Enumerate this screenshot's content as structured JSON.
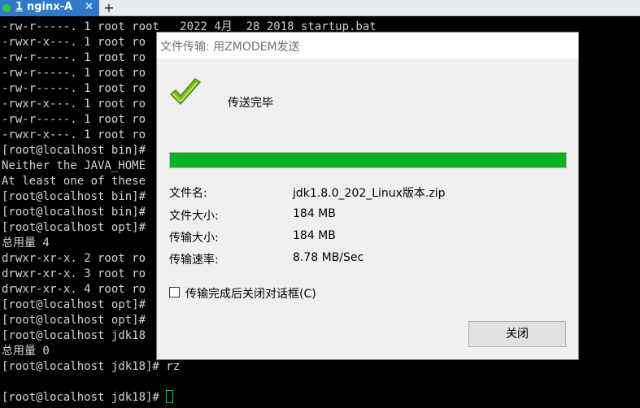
{
  "tabbar": {
    "active_tab": {
      "number": "1",
      "title": "nginx-A",
      "close_glyph": "✕",
      "status_color": "#27c93f",
      "color": "#3079c8"
    },
    "add_tab_glyph": "+"
  },
  "terminal": {
    "lines": [
      "-rw-r-----. 1 root root   2022 4月  28 2018 startup.bat",
      "-rwxr-x---. 1 root ro",
      "-rw-r-----. 1 root ro",
      "-rw-r-----. 1 root ro",
      "-rw-r-----. 1 root ro",
      "-rwxr-x---. 1 root ro",
      "-rw-r-----. 1 root ro",
      "-rwxr-x---. 1 root ro",
      "[root@localhost bin]#",
      "Neither the JAVA_HOME",
      "At least one of these",
      "[root@localhost bin]#",
      "[root@localhost bin]#",
      "[root@localhost opt]#",
      "总用量 4",
      "drwxr-xr-x. 2 root ro",
      "drwxr-xr-x. 3 root ro",
      "drwxr-xr-x. 4 root ro",
      "[root@localhost opt]#",
      "[root@localhost opt]#",
      "[root@localhost jdk18",
      "总用量 0",
      "[root@localhost jdk18]# rz",
      "",
      "[root@localhost jdk18]# "
    ],
    "cursor_color": "#27c93f"
  },
  "dialog": {
    "title": "文件传输: 用ZMODEM发送",
    "status": "传送完毕",
    "progress": 1.0,
    "progress_color": "#06b025",
    "info": [
      {
        "label": "文件名:",
        "value": "jdk1.8.0_202_Linux版本.zip"
      },
      {
        "label": "文件大小:",
        "value": "184 MB"
      },
      {
        "label": "传输大小:",
        "value": "184 MB"
      },
      {
        "label": "传输速率:",
        "value": "8.78 MB/Sec"
      }
    ],
    "close_after_label": "传输完成后关闭对话框(C)",
    "close_after_checked": false,
    "close_button_label": "关闭"
  }
}
